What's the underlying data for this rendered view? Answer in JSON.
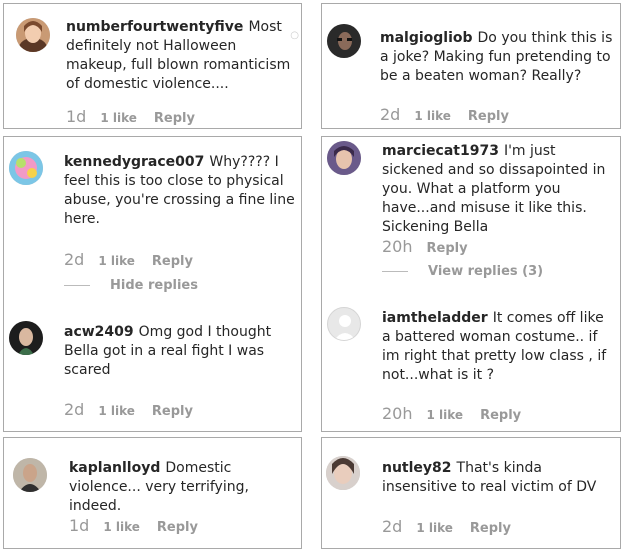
{
  "panels": {
    "p1": {
      "comment": {
        "username": "numberfourtwentyfive",
        "text": "Most definitely not Halloween makeup, full blown romanticism of domestic violence....",
        "time": "1d",
        "likes": "1 like",
        "reply": "Reply"
      }
    },
    "p2": {
      "comment": {
        "username": "malgiogliob",
        "text": "Do you think this is a joke? Making fun pretending to be a beaten woman? Really?",
        "time": "2d",
        "likes": "1 like",
        "reply": "Reply"
      }
    },
    "p3": {
      "comment": {
        "username": "kennedygrace007",
        "text": "Why???? I feel this is too close to physical abuse, you're crossing a fine line here.",
        "time": "2d",
        "likes": "1 like",
        "reply": "Reply"
      },
      "toggle": "Hide replies",
      "reply_comment": {
        "username": "acw2409",
        "text": "Omg god I thought Bella got in a real fight I was scared",
        "time": "2d",
        "likes": "1 like",
        "reply": "Reply"
      }
    },
    "p4": {
      "comment": {
        "username": "marciecat1973",
        "text": "I'm just sickened and so dissapointed in you. What a platform you have...and misuse it like this. Sickening Bella",
        "time": "20h",
        "reply": "Reply"
      },
      "toggle": "View replies (3)",
      "reply_comment": {
        "username": "iamtheladder",
        "text": "It comes off like a battered woman costume.. if im right that pretty low class , if not...what is it ?",
        "time": "20h",
        "likes": "1 like",
        "reply": "Reply"
      }
    },
    "p5": {
      "comment": {
        "username": "kaplanlloyd",
        "text": "Domestic violence... very terrifying, indeed.",
        "time": "1d",
        "likes": "1 like",
        "reply": "Reply"
      }
    },
    "p6": {
      "comment": {
        "username": "nutley82",
        "text": "That's kinda insensitive to real victim of DV",
        "time": "2d",
        "likes": "1 like",
        "reply": "Reply"
      }
    }
  },
  "colors": {
    "border": "#a9a9a9",
    "meta": "#999999",
    "text": "#262626"
  }
}
